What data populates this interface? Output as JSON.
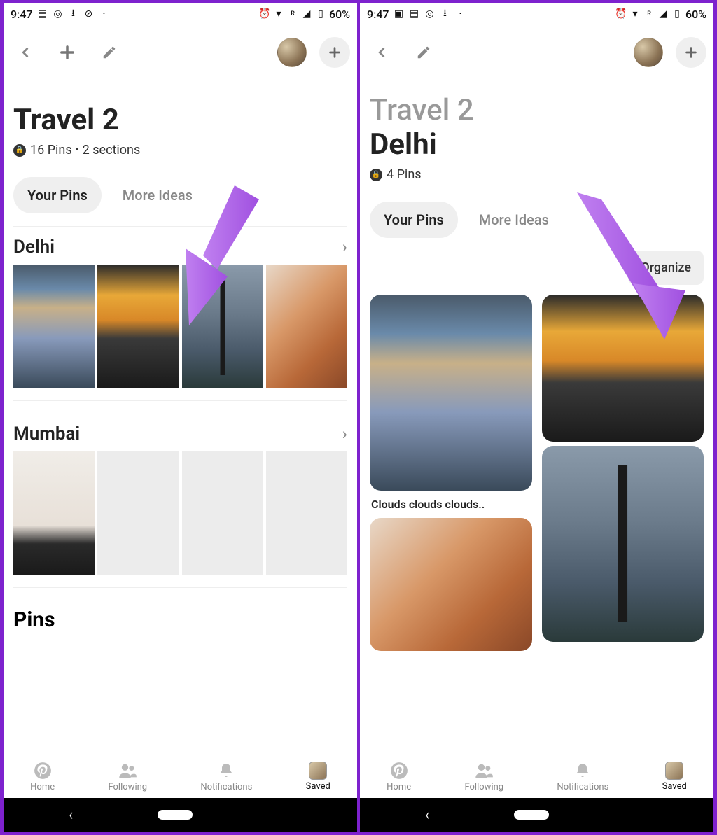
{
  "status": {
    "time": "9:47",
    "battery": "60%",
    "signal_label": "R"
  },
  "left": {
    "board_title": "Travel 2",
    "meta": "16 Pins • 2 sections",
    "tabs": {
      "your_pins": "Your Pins",
      "more_ideas": "More Ideas"
    },
    "sections": [
      {
        "name": "Delhi"
      },
      {
        "name": "Mumbai"
      }
    ],
    "pins_heading": "Pins"
  },
  "right": {
    "parent_title": "Travel 2",
    "section_title": "Delhi",
    "meta": "4 Pins",
    "tabs": {
      "your_pins": "Your Pins",
      "more_ideas": "More Ideas"
    },
    "organize": "Organize",
    "caption1": "Clouds clouds clouds.."
  },
  "nav": {
    "home": "Home",
    "following": "Following",
    "notifications": "Notifications",
    "saved": "Saved"
  }
}
